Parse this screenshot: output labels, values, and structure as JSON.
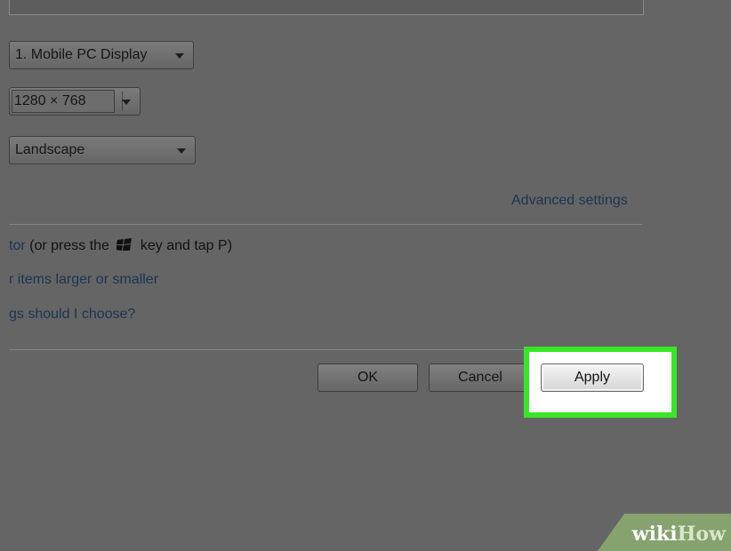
{
  "display": {
    "monitor_label": "1. Mobile PC Display",
    "resolution_label": "1280 × 768",
    "orientation_label": "Landscape"
  },
  "links": {
    "advanced_settings": "Advanced settings",
    "connect_projector_partial": "tor",
    "connect_projector_suffix_before_key": "(or press the",
    "connect_projector_suffix_after_key": "key and tap P)",
    "make_items_larger": "r items larger or smaller",
    "which_settings": "gs should I choose?"
  },
  "buttons": {
    "ok": "OK",
    "cancel": "Cancel",
    "apply": "Apply"
  },
  "watermark": {
    "wiki": "wiki",
    "how": "How"
  },
  "colors": {
    "highlight": "#37e627",
    "dim_background": "#656565",
    "watermark_band": "#86a26f"
  },
  "icons": {
    "windows_key": "windows-logo-icon",
    "dropdown": "chevron-down-icon"
  }
}
